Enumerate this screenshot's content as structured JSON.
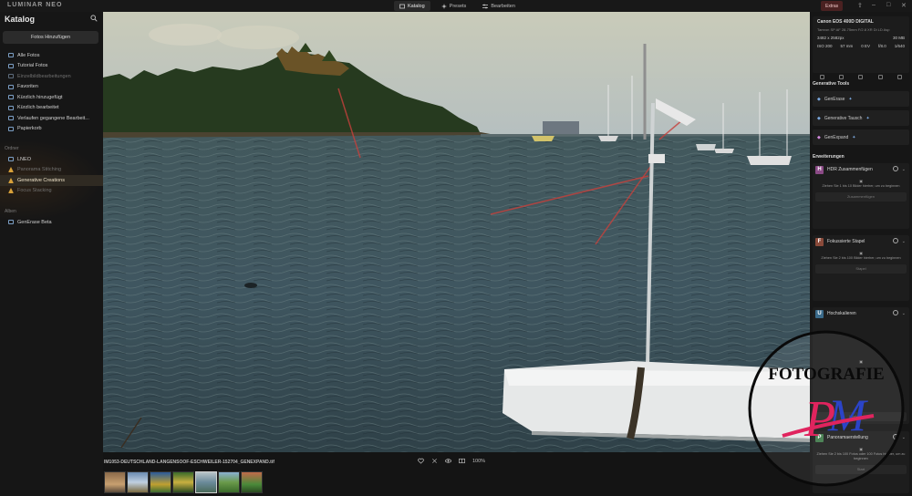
{
  "app": {
    "brand": "LUMINAR NEO"
  },
  "topnav": {
    "tabs": [
      {
        "label": "Katalog"
      },
      {
        "label": "Presets"
      },
      {
        "label": "Bearbeiten"
      }
    ]
  },
  "extras_label": "Extras",
  "sidebar": {
    "title": "Katalog",
    "add_button": "Fotos Hinzufügen",
    "items": [
      {
        "label": "Alle Fotos"
      },
      {
        "label": "Tutorial Fotos"
      },
      {
        "label": "Einzelbildbearbeitungen"
      },
      {
        "label": "Favoriten"
      },
      {
        "label": "Kürzlich hinzugefügt"
      },
      {
        "label": "Kürzlich bearbeitet"
      },
      {
        "label": "Verlaufen gegangene Bearbeit..."
      },
      {
        "label": "Papierkorb"
      }
    ],
    "ordner_label": "Ordner",
    "folders": [
      {
        "label": "LNEO"
      },
      {
        "label": "Panorama Stitching"
      },
      {
        "label": "Generative Creations"
      },
      {
        "label": "Focus Stacking"
      }
    ],
    "alben_label": "Alben",
    "albums": [
      {
        "label": "GenErase Beta"
      }
    ]
  },
  "bottom": {
    "filename": "IM1053-DEUTSCHLAND-LANGENSOOF-ESCHWEILER-152704_GENEXPAND.tif",
    "zoom": "100%"
  },
  "camera": {
    "model": "Canon EOS 400D DIGITAL",
    "lens": "Tamron SP AF 28-75mm F/2.8 XR Di LD Asp",
    "dims": "3482 x 2582px",
    "size": "30 MB",
    "iso": "ISO 200",
    "focal": "57 mm",
    "ev": "0 EV",
    "aperture": "f/8.0",
    "shutter": "1/640"
  },
  "generative": {
    "heading": "Generative Tools",
    "tools": [
      {
        "label": "GenErase"
      },
      {
        "label": "Generative Tausch"
      },
      {
        "label": "GenExpand"
      }
    ]
  },
  "extensions": {
    "heading": "Erweiterungen",
    "cards": [
      {
        "badge": "H",
        "color": "#8b4a86",
        "label": "HDR Zusammenfügen",
        "drop": "Ziehen Sie 1 bis 10 Bilder hierher, um zu beginnen",
        "action": "Zusammenfügen"
      },
      {
        "badge": "F",
        "color": "#8a4a3a",
        "label": "Fokussierte Stapel",
        "drop": "Ziehen Sie 2 bis 100 Bilder hierher, um zu beginnen",
        "action": "Stapel"
      },
      {
        "badge": "U",
        "color": "#3a6a8a",
        "label": "Hochskalieren",
        "drop": "",
        "action": "Hochskalieren"
      },
      {
        "badge": "P",
        "color": "#3f7a4a",
        "label": "Panoramaerstellung",
        "drop": "Ziehen Sie 2 bis 100 Fotos oder 100 Fotos hierher, um zu beginnen",
        "action": "Start"
      }
    ]
  },
  "watermark": {
    "line1": "FOTOGRAFIE",
    "initials": "PM"
  }
}
